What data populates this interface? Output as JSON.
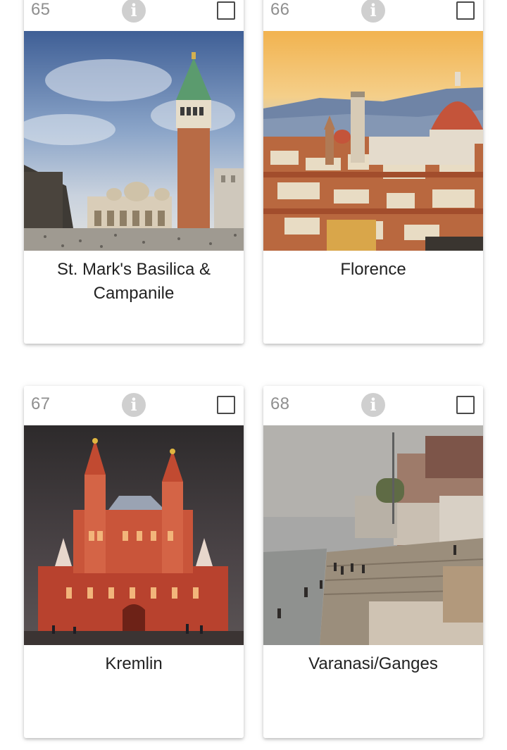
{
  "cards": [
    {
      "number": "65",
      "title": "St. Mark's Basilica & Campanile",
      "image": "St. Mark's Basilica & Campanile photo"
    },
    {
      "number": "66",
      "title": "Florence",
      "image": "Florence cityscape photo"
    },
    {
      "number": "67",
      "title": "Kremlin",
      "image": "Kremlin state museum photo"
    },
    {
      "number": "68",
      "title": "Varanasi/Ganges",
      "image": "Varanasi ghats on Ganges photo"
    }
  ],
  "info_icon_glyph": "i",
  "colors": {
    "number": "#8f8f8f",
    "info_icon": "#cfcfcf",
    "title": "#222222",
    "checkbox_border": "#4a4a4a"
  }
}
